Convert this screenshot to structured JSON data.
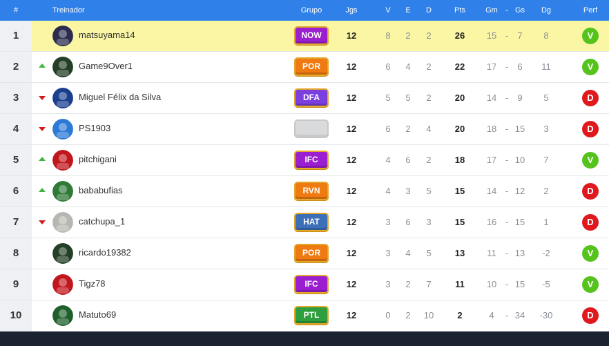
{
  "header": {
    "pos": "#",
    "coach": "Treinador",
    "group": "Grupo",
    "jgs": "Jgs",
    "v": "V",
    "e": "E",
    "d": "D",
    "pts": "Pts",
    "gm": "Gm",
    "dash": "-",
    "gs": "Gs",
    "dg": "Dg",
    "perf": "Perf"
  },
  "rows": [
    {
      "pos": "1",
      "trend": "none",
      "name": "matsuyama14",
      "group": "NOW",
      "group_color": "#9b1fd1",
      "jgs": "12",
      "v": "8",
      "e": "2",
      "d": "2",
      "pts": "26",
      "gm": "15",
      "gs": "7",
      "dg": "8",
      "perf": "V",
      "perf_color": "#55c31c",
      "avatar_color": "#2b2b4f",
      "highlight": true
    },
    {
      "pos": "2",
      "trend": "up",
      "name": "Game9Over1",
      "group": "POR",
      "group_color": "#f07a12",
      "jgs": "12",
      "v": "6",
      "e": "4",
      "d": "2",
      "pts": "22",
      "gm": "17",
      "gs": "6",
      "dg": "11",
      "perf": "V",
      "perf_color": "#55c31c",
      "avatar_color": "#233f25",
      "highlight": false
    },
    {
      "pos": "3",
      "trend": "down",
      "name": "Miguel Félix da Silva",
      "group": "DFA",
      "group_color": "#7b3fe0",
      "jgs": "12",
      "v": "5",
      "e": "5",
      "d": "2",
      "pts": "20",
      "gm": "14",
      "gs": "9",
      "dg": "5",
      "perf": "D",
      "perf_color": "#e0191f",
      "avatar_color": "#1b3f8f",
      "highlight": false
    },
    {
      "pos": "4",
      "trend": "down",
      "name": "PS1903",
      "group": "",
      "group_color": "#d9dadc",
      "jgs": "12",
      "v": "6",
      "e": "2",
      "d": "4",
      "pts": "20",
      "gm": "18",
      "gs": "15",
      "dg": "3",
      "perf": "D",
      "perf_color": "#e0191f",
      "avatar_color": "#2d7ad6",
      "highlight": false
    },
    {
      "pos": "5",
      "trend": "up",
      "name": "pitchigani",
      "group": "IFC",
      "group_color": "#9b1fd1",
      "jgs": "12",
      "v": "4",
      "e": "6",
      "d": "2",
      "pts": "18",
      "gm": "17",
      "gs": "10",
      "dg": "7",
      "perf": "V",
      "perf_color": "#55c31c",
      "avatar_color": "#c0161c",
      "highlight": false
    },
    {
      "pos": "6",
      "trend": "up",
      "name": "bababufias",
      "group": "RVN",
      "group_color": "#f07a12",
      "jgs": "12",
      "v": "4",
      "e": "3",
      "d": "5",
      "pts": "15",
      "gm": "14",
      "gs": "12",
      "dg": "2",
      "perf": "D",
      "perf_color": "#e0191f",
      "avatar_color": "#2f7a36",
      "highlight": false
    },
    {
      "pos": "7",
      "trend": "down",
      "name": "catchupa_1",
      "group": "HAT",
      "group_color": "#3b6fb7",
      "jgs": "12",
      "v": "3",
      "e": "6",
      "d": "3",
      "pts": "15",
      "gm": "16",
      "gs": "15",
      "dg": "1",
      "perf": "D",
      "perf_color": "#e0191f",
      "avatar_color": "#b7b7b2",
      "highlight": false
    },
    {
      "pos": "8",
      "trend": "none",
      "name": "ricardo19382",
      "group": "POR",
      "group_color": "#f07a12",
      "jgs": "12",
      "v": "3",
      "e": "4",
      "d": "5",
      "pts": "13",
      "gm": "11",
      "gs": "13",
      "dg": "-2",
      "perf": "V",
      "perf_color": "#55c31c",
      "avatar_color": "#233f25",
      "highlight": false
    },
    {
      "pos": "9",
      "trend": "none",
      "name": "Tigz78",
      "group": "IFC",
      "group_color": "#9b1fd1",
      "jgs": "12",
      "v": "3",
      "e": "2",
      "d": "7",
      "pts": "11",
      "gm": "10",
      "gs": "15",
      "dg": "-5",
      "perf": "V",
      "perf_color": "#55c31c",
      "avatar_color": "#c0161c",
      "highlight": false
    },
    {
      "pos": "10",
      "trend": "none",
      "name": "Matuto69",
      "group": "PTL",
      "group_color": "#2e9e3e",
      "jgs": "12",
      "v": "0",
      "e": "2",
      "d": "10",
      "pts": "2",
      "gm": "4",
      "gs": "34",
      "dg": "-30",
      "perf": "D",
      "perf_color": "#e0191f",
      "avatar_color": "#1f5f2b",
      "highlight": false
    }
  ]
}
